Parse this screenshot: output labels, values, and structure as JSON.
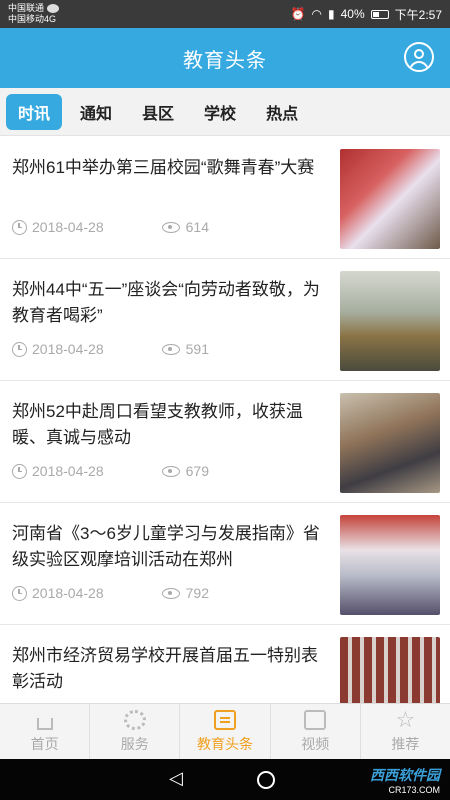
{
  "statusbar": {
    "carrier1": "中国联通",
    "carrier2": "中国移动4G",
    "battery": "40%",
    "time": "下午2:57"
  },
  "header": {
    "title": "教育头条"
  },
  "tabs": [
    {
      "label": "时讯",
      "active": true
    },
    {
      "label": "通知"
    },
    {
      "label": "县区"
    },
    {
      "label": "学校"
    },
    {
      "label": "热点"
    }
  ],
  "news": [
    {
      "title": "郑州61中举办第三届校园“歌舞青春”大赛",
      "date": "2018-04-28",
      "views": "614"
    },
    {
      "title": "郑州44中“五一”座谈会“向劳动者致敬，为教育者喝彩”",
      "date": "2018-04-28",
      "views": "591"
    },
    {
      "title": "郑州52中赴周口看望支教教师，收获温暖、真诚与感动",
      "date": "2018-04-28",
      "views": "679"
    },
    {
      "title": "河南省《3～6岁儿童学习与发展指南》省级实验区观摩培训活动在郑州",
      "date": "2018-04-28",
      "views": "792"
    },
    {
      "title": "郑州市经济贸易学校开展首届五一特别表彰活动",
      "date": "",
      "views": ""
    }
  ],
  "bottomnav": [
    {
      "label": "首页",
      "icon": "home-icon"
    },
    {
      "label": "服务",
      "icon": "gear-icon"
    },
    {
      "label": "教育头条",
      "icon": "news-icon",
      "active": true
    },
    {
      "label": "视频",
      "icon": "video-icon"
    },
    {
      "label": "推荐",
      "icon": "star-icon"
    }
  ],
  "watermark": {
    "text": "西西软件园",
    "sub": "CR173.COM"
  },
  "colors": {
    "primary": "#36a9e1",
    "active_nav": "#f0a020"
  }
}
